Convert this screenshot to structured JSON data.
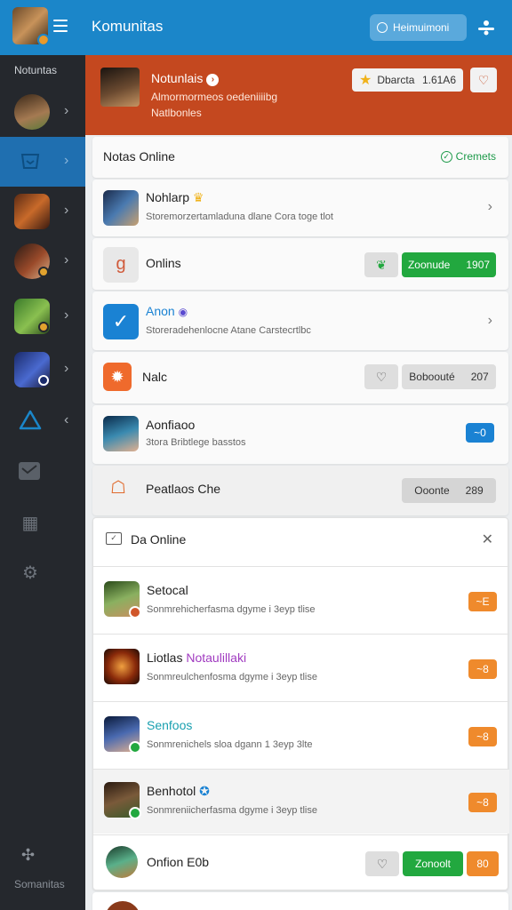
{
  "app": {
    "title": "Komunitas",
    "top_button_label": "Heimuimoni",
    "colors": {
      "topbar": "#1b86c9",
      "hero": "#c4481f",
      "sidebar": "#25282d",
      "accent_green": "#22a83f",
      "accent_orange": "#ef8a2c"
    }
  },
  "sidebar": {
    "header": "Notuntas",
    "footer": "Somanitas",
    "items": [
      {
        "icon": "avatar"
      },
      {
        "icon": "box-icon"
      },
      {
        "icon": "avatar"
      },
      {
        "icon": "avatar"
      },
      {
        "icon": "avatar"
      },
      {
        "icon": "avatar"
      },
      {
        "icon": "triangle-icon"
      },
      {
        "icon": "mail-icon"
      },
      {
        "icon": "grid-icon"
      },
      {
        "icon": "gear-icon"
      }
    ]
  },
  "hero": {
    "name": "Notunlais",
    "line1": "Almormormeos oedeniiiibg",
    "line2": "Natlbonles",
    "pill_label": "Dbarcta",
    "pill_value": "1.61A6"
  },
  "online_section": {
    "title": "Notas Online",
    "link": "Cremets",
    "rows": [
      {
        "title": "Nohlarp",
        "sub": "Storemorzertamladuna dlane Cora toge tlot"
      },
      {
        "title": "Onlins",
        "pill_label": "Zoonude",
        "pill_value": "1907"
      },
      {
        "title": "Anon",
        "sub": "Storeradehenlocne Atane Carstecrtlbc"
      },
      {
        "title": "Nalc",
        "pill_label": "Boboouté",
        "pill_value": "207"
      },
      {
        "title": "Aonfiaoo",
        "sub": "3tora Bribtlege basstos",
        "pill_label": "~0"
      },
      {
        "title": "Peatlaos Che",
        "pill_label": "Ooonte",
        "pill_value": "289"
      }
    ]
  },
  "da_online": {
    "title": "Da Online",
    "friends": [
      {
        "title": "Setocal",
        "sub": "Sonmrehicherfasma dgyme i 3eyp tlise",
        "badge": "~E"
      },
      {
        "title": "Liotlas",
        "highlight": "Notaulillaki",
        "sub": "Sonmreulchenfosma dgyme i 3eyp tlise",
        "badge": "~8"
      },
      {
        "title": "Senfoos",
        "sub": "Sonmrenichels sloa dgann 1 3eyp 3lte",
        "badge": "~8"
      },
      {
        "title": "Benhotol",
        "sub": "Sonmreniicherfasma dgyme i 3eyp tlise",
        "badge": "~8"
      },
      {
        "title": "Onfion E0b",
        "pill_label": "Zonoolt",
        "badge": "80"
      }
    ]
  }
}
